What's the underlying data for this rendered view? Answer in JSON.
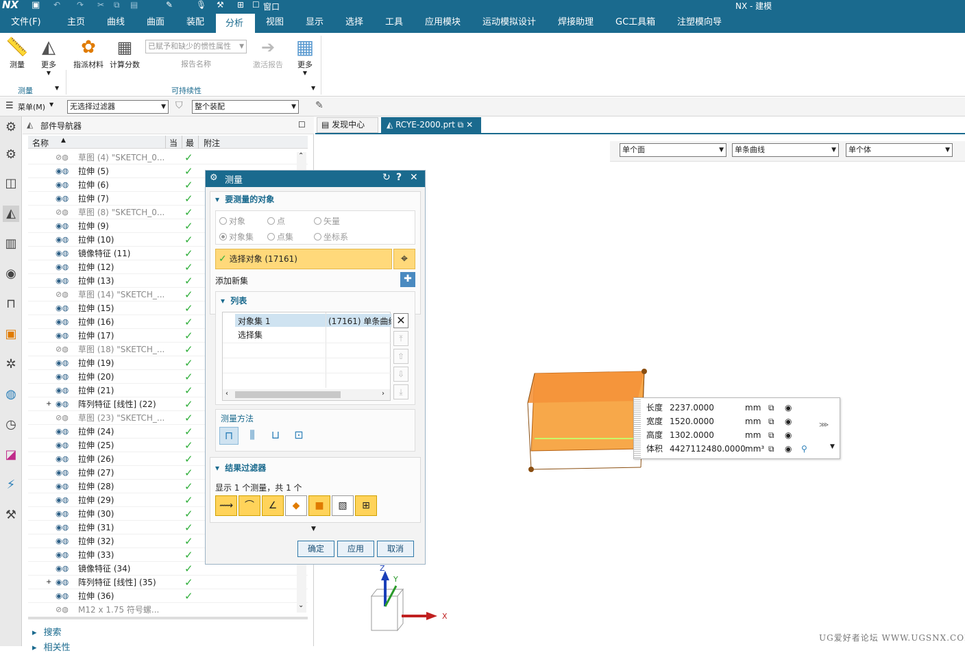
{
  "window": {
    "logo": "NX",
    "title": "NX - 建模",
    "window_menu": "窗口"
  },
  "menu": {
    "items": [
      "文件(F)",
      "主页",
      "曲线",
      "曲面",
      "装配",
      "分析",
      "视图",
      "显示",
      "选择",
      "工具",
      "应用模块",
      "运动模拟设计",
      "焊接助理",
      "GC工具箱",
      "注塑模向导"
    ],
    "active": "分析"
  },
  "ribbon": {
    "measure": "测量",
    "more1": "更多",
    "assign_material": "指派材料",
    "calc_score": "计算分数",
    "report_combo": "已赋予和缺少的惯性属性",
    "report_name": "报告名称",
    "activate_report": "激活报告",
    "more2": "更多",
    "group_measure": "测量",
    "group_sustain": "可持续性"
  },
  "toolbar2": {
    "menu": "菜单(M)",
    "filter": "无选择过滤器",
    "assembly": "整个装配"
  },
  "nav": {
    "title": "部件导航器",
    "col_name": "名称",
    "col_current": "当",
    "col_latest": "最",
    "col_note": "附注",
    "rows": [
      {
        "name": "草图 (4) \"SKETCH_0...",
        "gray": true
      },
      {
        "name": "拉伸 (5)"
      },
      {
        "name": "拉伸 (6)"
      },
      {
        "name": "拉伸 (7)"
      },
      {
        "name": "草图 (8) \"SKETCH_0...",
        "gray": true
      },
      {
        "name": "拉伸 (9)"
      },
      {
        "name": "拉伸 (10)"
      },
      {
        "name": "镜像特征 (11)"
      },
      {
        "name": "拉伸 (12)"
      },
      {
        "name": "拉伸 (13)"
      },
      {
        "name": "草图 (14) \"SKETCH_...",
        "gray": true
      },
      {
        "name": "拉伸 (15)"
      },
      {
        "name": "拉伸 (16)"
      },
      {
        "name": "拉伸 (17)"
      },
      {
        "name": "草图 (18) \"SKETCH_...",
        "gray": true
      },
      {
        "name": "拉伸 (19)"
      },
      {
        "name": "拉伸 (20)"
      },
      {
        "name": "拉伸 (21)"
      },
      {
        "name": "阵列特征 [线性] (22)",
        "expand": true
      },
      {
        "name": "草图 (23) \"SKETCH_...",
        "gray": true
      },
      {
        "name": "拉伸 (24)"
      },
      {
        "name": "拉伸 (25)"
      },
      {
        "name": "拉伸 (26)"
      },
      {
        "name": "拉伸 (27)"
      },
      {
        "name": "拉伸 (28)"
      },
      {
        "name": "拉伸 (29)"
      },
      {
        "name": "拉伸 (30)"
      },
      {
        "name": "拉伸 (31)"
      },
      {
        "name": "拉伸 (32)"
      },
      {
        "name": "拉伸 (33)"
      },
      {
        "name": "镜像特征 (34)"
      },
      {
        "name": "阵列特征 [线性] (35)",
        "expand": true
      },
      {
        "name": "拉伸 (36)"
      },
      {
        "name": "M12 x 1.75 符号螺...",
        "gray": true,
        "nocheck": true
      }
    ],
    "search": "搜索",
    "dependency": "相关性"
  },
  "tabs": {
    "discovery": "发现中心",
    "part": "RCYE-2000.prt"
  },
  "viewport_filters": {
    "face": "单个面",
    "curve": "单条曲线",
    "body": "单个体"
  },
  "dialog": {
    "title": "测量",
    "sec_objects": "要测量的对象",
    "radio_object": "对象",
    "radio_point": "点",
    "radio_vector": "矢量",
    "radio_objset": "对象集",
    "radio_pointset": "点集",
    "radio_csys": "坐标系",
    "select_object": "选择对象 (17161)",
    "add_set": "添加新集",
    "sec_list": "列表",
    "list_row1": "对象集 1",
    "list_row1_val": "(17161) 单条曲线",
    "list_row2": "选择集",
    "method": "测量方法",
    "sec_filter": "结果过滤器",
    "filter_info": "显示 1 个测量，共 1 个",
    "ok": "确定",
    "apply": "应用",
    "cancel": "取消"
  },
  "measure_results": [
    {
      "label": "长度",
      "value": "2237.0000",
      "unit": "mm"
    },
    {
      "label": "宽度",
      "value": "1520.0000",
      "unit": "mm"
    },
    {
      "label": "高度",
      "value": "1302.0000",
      "unit": "mm"
    },
    {
      "label": "体积",
      "value": "4427112480.0000",
      "unit": "mm³"
    }
  ],
  "axes": {
    "x": "X",
    "y": "Y",
    "z": "Z"
  },
  "watermark": "UG爱好者论坛 WWW.UGSNX.COM"
}
